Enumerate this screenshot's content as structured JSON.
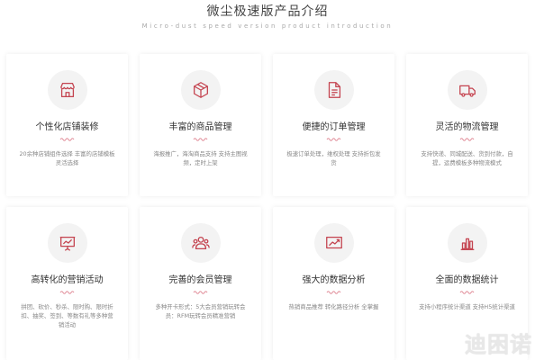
{
  "header": {
    "title": "微尘极速版产品介绍",
    "subtitle": "Micro-dust speed version product introduction"
  },
  "colors": {
    "accent": "#c4434f",
    "wave": "#e08a97",
    "icon_bg": "#f3f3f3"
  },
  "features": [
    {
      "icon": "storefront-icon",
      "title": "个性化店铺装修",
      "desc": "20余种店铺组件选择 丰富的店铺模板灵活选择"
    },
    {
      "icon": "package-box-icon",
      "title": "丰富的商品管理",
      "desc": "海报推广，海淘商品支持 支持主图视频，定时上架"
    },
    {
      "icon": "document-icon",
      "title": "便捷的订单管理",
      "desc": "极速订单处理，维权处理 支持折包发货"
    },
    {
      "icon": "delivery-truck-icon",
      "title": "灵活的物流管理",
      "desc": "支持快递、同城配送、货到付款，自提，运费模板多种物流模式"
    },
    {
      "icon": "presentation-board-icon",
      "title": "高转化的营销活动",
      "desc": "拼团、砍价、秒杀、限时购、限时折扣、抽奖、签到、等数有礼等多种营销活动"
    },
    {
      "icon": "members-group-icon",
      "title": "完善的会员管理",
      "desc": "多种开卡形式：5大会员营销玩转会员：RFM玩转会员精准营销"
    },
    {
      "icon": "trend-chart-icon",
      "title": "强大的数据分析",
      "desc": "热销商品推荐 转化路径分析 全掌握"
    },
    {
      "icon": "bar-stats-icon",
      "title": "全面的数据统计",
      "desc": "支持小程序统计渠道 支持H5统计渠道"
    }
  ],
  "watermark": {
    "text": "迪困诺"
  }
}
